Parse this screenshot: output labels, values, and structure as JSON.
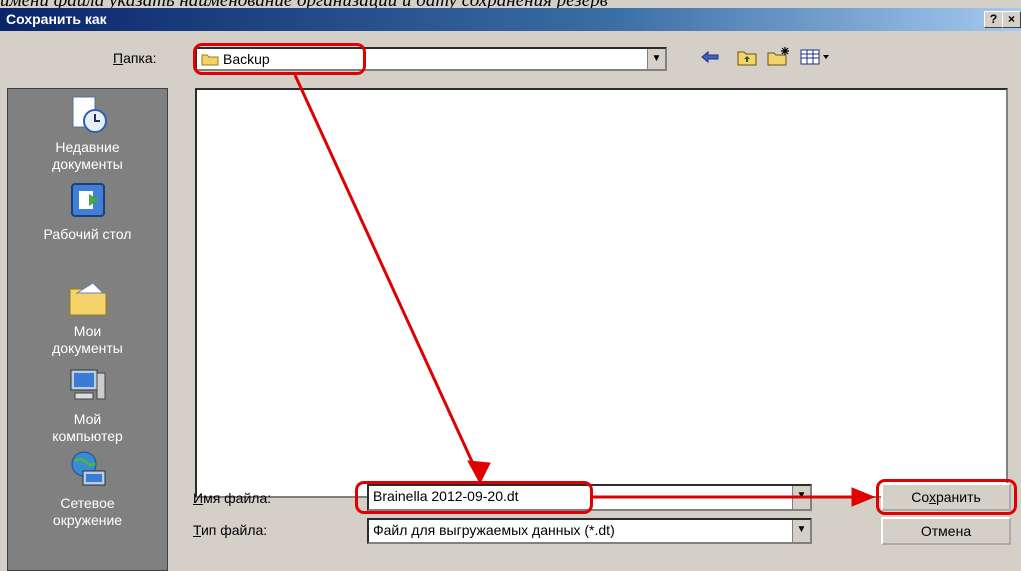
{
  "caption": "имени файла указать наименование организации и дату сохранения резерв",
  "window": {
    "title": "Сохранить как",
    "help_button": "?",
    "close_button": "×"
  },
  "folder": {
    "label": "Папка:",
    "accesskey": "П",
    "label_rest": "апка:",
    "value": "Backup"
  },
  "toolbar_icons": [
    "back-arrow-icon",
    "up-folder-icon",
    "new-folder-icon",
    "view-menu-icon"
  ],
  "places": [
    {
      "label": "Недавние\nдокументы",
      "icon": "recent-documents-icon"
    },
    {
      "label": "Рабочий стол",
      "icon": "desktop-icon"
    },
    {
      "label": "Мои\nдокументы",
      "icon": "my-documents-icon"
    },
    {
      "label": "Мой\nкомпьютер",
      "icon": "my-computer-icon"
    },
    {
      "label": "Сетевое\nокружение",
      "icon": "network-icon"
    }
  ],
  "filename": {
    "label_key": "И",
    "label_rest": "мя файла:",
    "value": "Brainella 2012-09-20.dt"
  },
  "filetype": {
    "label_key": "Т",
    "label_rest": "ип файла:",
    "value": "Файл для выгружаемых данных (*.dt)"
  },
  "buttons": {
    "save_pre": "Со",
    "save_key": "х",
    "save_post": "ранить",
    "cancel": "Отмена"
  },
  "annotation_color": "#e00000"
}
